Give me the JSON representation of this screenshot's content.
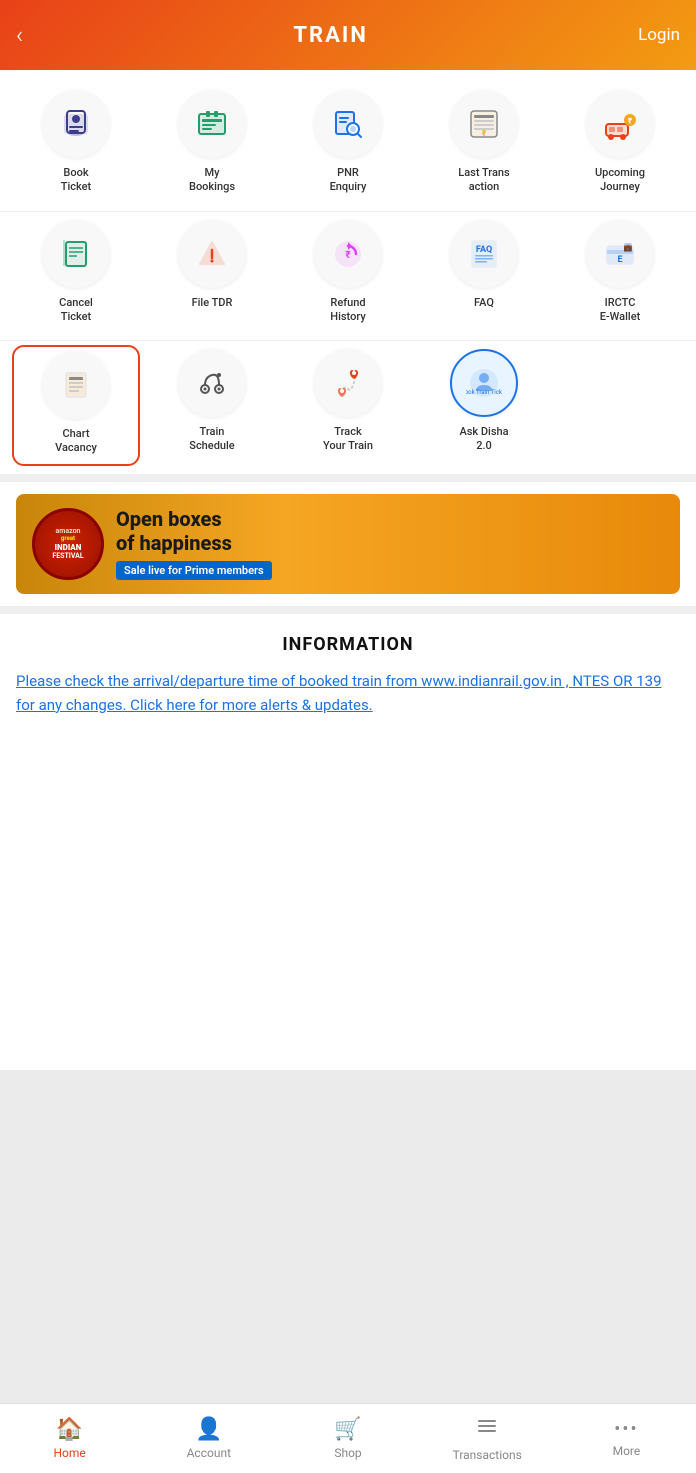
{
  "header": {
    "title": "TRAIN",
    "back_label": "‹",
    "login_label": "Login"
  },
  "grid_row1": [
    {
      "id": "book-ticket",
      "label": "Book\nTicket",
      "icon": "🚆",
      "selected": false
    },
    {
      "id": "my-bookings",
      "label": "My\nBookings",
      "icon": "🎫",
      "selected": false
    },
    {
      "id": "pnr-enquiry",
      "label": "PNR\nEnquiry",
      "icon": "🔍",
      "selected": false
    },
    {
      "id": "last-transaction",
      "label": "Last Trans\naction",
      "icon": "🖩",
      "selected": false
    },
    {
      "id": "upcoming-journey",
      "label": "Upcoming\nJourney",
      "icon": "🚌",
      "selected": false
    }
  ],
  "grid_row2": [
    {
      "id": "cancel-ticket",
      "label": "Cancel\nTicket",
      "icon": "📄",
      "selected": false
    },
    {
      "id": "file-tdr",
      "label": "File TDR",
      "icon": "⚠️",
      "selected": false
    },
    {
      "id": "refund-history",
      "label": "Refund\nHistory",
      "icon": "💰",
      "selected": false
    },
    {
      "id": "faq",
      "label": "FAQ",
      "icon": "📋",
      "selected": false
    },
    {
      "id": "irctc-ewallet",
      "label": "IRCTC\nE-Wallet",
      "icon": "💳",
      "selected": false
    }
  ],
  "grid_row3": [
    {
      "id": "chart-vacancy",
      "label": "Chart\nVacancy",
      "icon": "🗒️",
      "selected": true
    },
    {
      "id": "train-schedule",
      "label": "Train\nSchedule",
      "icon": "🗺️",
      "selected": false
    },
    {
      "id": "track-your-train",
      "label": "Track\nYour Train",
      "icon": "📍",
      "selected": false
    },
    {
      "id": "ask-disha",
      "label": "Ask Disha\n2.0",
      "icon": "🤖",
      "selected": false
    }
  ],
  "banner": {
    "circle_line1": "great",
    "circle_line2": "INDIAN",
    "circle_line3": "FESTIVAL",
    "main_text": "Open boxes\nof happiness",
    "sub_text": "Sale live for Prime members"
  },
  "information": {
    "title": "INFORMATION",
    "link_text": "Please check the arrival/departure time of booked train from www.indianrail.gov.in , NTES OR 139 for any changes. Click here for more alerts & updates."
  },
  "bottom_nav": {
    "items": [
      {
        "id": "home",
        "label": "Home",
        "icon": "🏠",
        "active": true
      },
      {
        "id": "account",
        "label": "Account",
        "icon": "👤",
        "active": false
      },
      {
        "id": "shop",
        "label": "Shop",
        "icon": "🛒",
        "active": false
      },
      {
        "id": "transactions",
        "label": "Transactions",
        "icon": "☰",
        "active": false
      },
      {
        "id": "more",
        "label": "More",
        "icon": "···",
        "active": false
      }
    ]
  }
}
